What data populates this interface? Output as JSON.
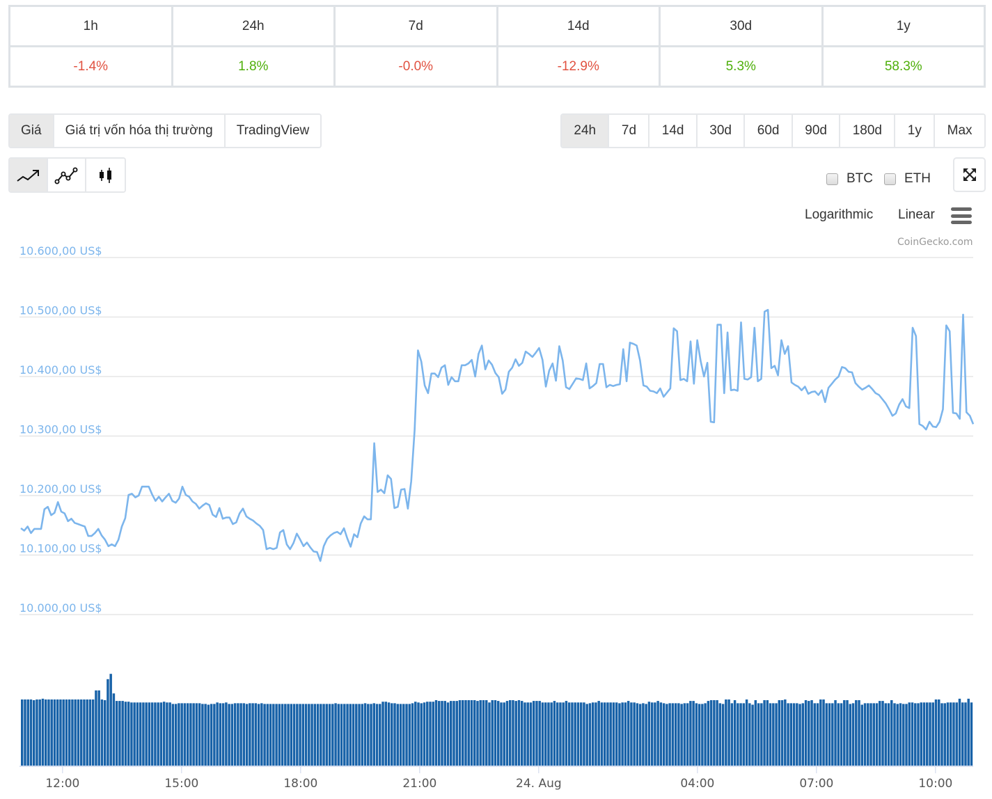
{
  "changes": {
    "periods": [
      "1h",
      "24h",
      "7d",
      "14d",
      "30d",
      "1y"
    ],
    "values": [
      {
        "text": "-1.4%",
        "dir": "neg"
      },
      {
        "text": "1.8%",
        "dir": "pos"
      },
      {
        "text": "-0.0%",
        "dir": "neg"
      },
      {
        "text": "-12.9%",
        "dir": "neg"
      },
      {
        "text": "5.3%",
        "dir": "pos"
      },
      {
        "text": "58.3%",
        "dir": "pos"
      }
    ]
  },
  "colors": {
    "negative": "#e15241",
    "positive": "#4eaf0a",
    "price_line": "#7cb5ec",
    "volume_bar": "#1862a8",
    "grid": "#e6e6e6"
  },
  "tabs": {
    "items": [
      "Giá",
      "Giá trị vốn hóa thị trường",
      "TradingView"
    ],
    "active": 0
  },
  "ranges": {
    "items": [
      "24h",
      "7d",
      "14d",
      "30d",
      "60d",
      "90d",
      "180d",
      "1y",
      "Max"
    ],
    "active": 0
  },
  "chart_types": {
    "items": [
      {
        "icon": "line-chart-icon",
        "label": "Line"
      },
      {
        "icon": "line-points-chart-icon",
        "label": "Line with points"
      },
      {
        "icon": "candlestick-chart-icon",
        "label": "Candlestick"
      }
    ],
    "active": 0
  },
  "compare": {
    "btc_label": "BTC",
    "btc_checked": false,
    "eth_label": "ETH",
    "eth_checked": false
  },
  "scale": {
    "logarithmic_label": "Logarithmic",
    "linear_label": "Linear"
  },
  "credit": "CoinGecko.com",
  "chart_data": {
    "type": "line",
    "title": "",
    "xlabel": "",
    "ylabel": "",
    "grid": true,
    "legend": "none",
    "ylim": [
      10000,
      10600
    ],
    "y_ticks": [
      {
        "value": 10600,
        "label": "10.600,00 US$"
      },
      {
        "value": 10500,
        "label": "10.500,00 US$"
      },
      {
        "value": 10400,
        "label": "10.400,00 US$"
      },
      {
        "value": 10300,
        "label": "10.300,00 US$"
      },
      {
        "value": 10200,
        "label": "10.200,00 US$"
      },
      {
        "value": 10100,
        "label": "10.100,00 US$"
      },
      {
        "value": 10000,
        "label": "10.000,00 US$"
      }
    ],
    "x_range_hours": [
      -1.05,
      22.95
    ],
    "x_ticks": [
      {
        "hour": 0,
        "label": "12:00"
      },
      {
        "hour": 3,
        "label": "15:00"
      },
      {
        "hour": 6,
        "label": "18:00"
      },
      {
        "hour": 9,
        "label": "21:00"
      },
      {
        "hour": 12,
        "label": "24. Aug"
      },
      {
        "hour": 16,
        "label": "04:00"
      },
      {
        "hour": 19,
        "label": "07:00"
      },
      {
        "hour": 22,
        "label": "10:00"
      }
    ],
    "series": [
      {
        "name": "Price (USD)",
        "x_hours_start": -1.05,
        "x_hours_step": 0.0833,
        "values": [
          10145,
          10141,
          10148,
          10137,
          10144,
          10144,
          10144,
          10177,
          10181,
          10167,
          10171,
          10189,
          10173,
          10170,
          10157,
          10161,
          10154,
          10152,
          10150,
          10148,
          10132,
          10132,
          10137,
          10144,
          10133,
          10126,
          10115,
          10118,
          10115,
          10126,
          10148,
          10162,
          10201,
          10203,
          10197,
          10200,
          10215,
          10215,
          10215,
          10202,
          10191,
          10198,
          10190,
          10197,
          10203,
          10191,
          10188,
          10195,
          10215,
          10201,
          10198,
          10190,
          10186,
          10178,
          10183,
          10187,
          10184,
          10168,
          10164,
          10179,
          10161,
          10163,
          10163,
          10152,
          10155,
          10170,
          10178,
          10165,
          10161,
          10158,
          10153,
          10149,
          10142,
          10110,
          10112,
          10110,
          10112,
          10138,
          10142,
          10118,
          10110,
          10120,
          10136,
          10126,
          10115,
          10121,
          10113,
          10106,
          10105,
          10090,
          10115,
          10127,
          10133,
          10137,
          10139,
          10135,
          10145,
          10128,
          10114,
          10135,
          10130,
          10153,
          10165,
          10160,
          10160,
          10288,
          10206,
          10210,
          10204,
          10234,
          10228,
          10179,
          10181,
          10210,
          10211,
          10178,
          10224,
          10310,
          10444,
          10425,
          10385,
          10372,
          10405,
          10405,
          10399,
          10415,
          10419,
          10386,
          10399,
          10392,
          10392,
          10419,
          10419,
          10422,
          10428,
          10400,
          10438,
          10452,
          10412,
          10427,
          10420,
          10406,
          10399,
          10371,
          10378,
          10408,
          10415,
          10429,
          10418,
          10423,
          10442,
          10438,
          10433,
          10440,
          10448,
          10428,
          10383,
          10410,
          10422,
          10393,
          10451,
          10427,
          10382,
          10379,
          10388,
          10397,
          10396,
          10394,
          10422,
          10380,
          10384,
          10389,
          10421,
          10421,
          10382,
          10386,
          10384,
          10386,
          10387,
          10446,
          10392,
          10457,
          10455,
          10452,
          10427,
          10385,
          10383,
          10376,
          10375,
          10372,
          10380,
          10366,
          10373,
          10380,
          10481,
          10476,
          10394,
          10396,
          10392,
          10459,
          10388,
          10461,
          10426,
          10400,
          10423,
          10324,
          10323,
          10487,
          10487,
          10372,
          10474,
          10377,
          10378,
          10376,
          10491,
          10396,
          10395,
          10399,
          10482,
          10392,
          10396,
          10509,
          10512,
          10414,
          10418,
          10402,
          10461,
          10438,
          10451,
          10390,
          10386,
          10383,
          10377,
          10383,
          10371,
          10374,
          10375,
          10369,
          10377,
          10357,
          10381,
          10388,
          10395,
          10400,
          10416,
          10414,
          10408,
          10407,
          10389,
          10383,
          10378,
          10381,
          10385,
          10379,
          10372,
          10369,
          10362,
          10355,
          10345,
          10334,
          10338,
          10353,
          10362,
          10350,
          10347,
          10482,
          10468,
          10320,
          10317,
          10311,
          10324,
          10316,
          10315,
          10324,
          10345,
          10486,
          10476,
          10339,
          10338,
          10329,
          10504,
          10340,
          10334,
          10320
        ]
      },
      {
        "name": "Volume",
        "values_relative": [
          0.88,
          0.88,
          0.88,
          0.88,
          0.87,
          0.88,
          0.88,
          0.89,
          0.88,
          0.88,
          0.88,
          0.88,
          0.88,
          0.88,
          0.88,
          0.88,
          0.88,
          0.88,
          0.88,
          0.88,
          0.88,
          0.88,
          0.88,
          0.88,
          0.88,
          1.0,
          1.0,
          0.88,
          0.87,
          1.15,
          1.22,
          0.96,
          0.86,
          0.86,
          0.86,
          0.85,
          0.85,
          0.84,
          0.84,
          0.84,
          0.84,
          0.84,
          0.84,
          0.84,
          0.84,
          0.84,
          0.84,
          0.84,
          0.85,
          0.84,
          0.84,
          0.82,
          0.82,
          0.83,
          0.83,
          0.83,
          0.83,
          0.83,
          0.83,
          0.83,
          0.83,
          0.82,
          0.82,
          0.81,
          0.82,
          0.82,
          0.84,
          0.83,
          0.83,
          0.84,
          0.82,
          0.82,
          0.83,
          0.83,
          0.83,
          0.83,
          0.82,
          0.83,
          0.83,
          0.83,
          0.82,
          0.83,
          0.82,
          0.82,
          0.82,
          0.82,
          0.82,
          0.82,
          0.82,
          0.82,
          0.82,
          0.82,
          0.82,
          0.82,
          0.82,
          0.82,
          0.82,
          0.82,
          0.82,
          0.82,
          0.82,
          0.82,
          0.82,
          0.82,
          0.82,
          0.82,
          0.83,
          0.82,
          0.82,
          0.82,
          0.82,
          0.82,
          0.82,
          0.82,
          0.82,
          0.82,
          0.83,
          0.82,
          0.82,
          0.83,
          0.82,
          0.82,
          0.85,
          0.85,
          0.84,
          0.83,
          0.83,
          0.82,
          0.82,
          0.82,
          0.82,
          0.82,
          0.83,
          0.85,
          0.84,
          0.83,
          0.84,
          0.85,
          0.85,
          0.85,
          0.87,
          0.86,
          0.86,
          0.86,
          0.84,
          0.86,
          0.86,
          0.86,
          0.87,
          0.87,
          0.87,
          0.87,
          0.87,
          0.87,
          0.86,
          0.87,
          0.87,
          0.87,
          0.84,
          0.87,
          0.87,
          0.86,
          0.84,
          0.84,
          0.86,
          0.87,
          0.87,
          0.86,
          0.87,
          0.86,
          0.84,
          0.84,
          0.84,
          0.86,
          0.86,
          0.86,
          0.84,
          0.84,
          0.84,
          0.84,
          0.86,
          0.84,
          0.84,
          0.84,
          0.86,
          0.84,
          0.84,
          0.84,
          0.84,
          0.84,
          0.84,
          0.82,
          0.83,
          0.84,
          0.84,
          0.86,
          0.84,
          0.84,
          0.84,
          0.84,
          0.84,
          0.84,
          0.83,
          0.84,
          0.84,
          0.86,
          0.84,
          0.84,
          0.83,
          0.82,
          0.83,
          0.82,
          0.85,
          0.84,
          0.84,
          0.86,
          0.84,
          0.83,
          0.82,
          0.83,
          0.83,
          0.83,
          0.83,
          0.82,
          0.83,
          0.83,
          0.86,
          0.86,
          0.83,
          0.82,
          0.82,
          0.83,
          0.86,
          0.87,
          0.87,
          0.87,
          0.83,
          0.82,
          0.88,
          0.88,
          0.83,
          0.87,
          0.83,
          0.83,
          0.83,
          0.88,
          0.83,
          0.81,
          0.87,
          0.83,
          0.83,
          0.87,
          0.87,
          0.83,
          0.83,
          0.83,
          0.87,
          0.87,
          0.88,
          0.83,
          0.83,
          0.83,
          0.83,
          0.82,
          0.83,
          0.87,
          0.86,
          0.87,
          0.83,
          0.83,
          0.88,
          0.88,
          0.83,
          0.83,
          0.83,
          0.87,
          0.83,
          0.83,
          0.87,
          0.87,
          0.82,
          0.83,
          0.87,
          0.87,
          0.81,
          0.83,
          0.83,
          0.83,
          0.83,
          0.83,
          0.86,
          0.86,
          0.83,
          0.83,
          0.87,
          0.83,
          0.82,
          0.83,
          0.82,
          0.82,
          0.84,
          0.84,
          0.83,
          0.83,
          0.84,
          0.84,
          0.84,
          0.84,
          0.84,
          0.88,
          0.88,
          0.83,
          0.83,
          0.84,
          0.84,
          0.84,
          0.84,
          0.89,
          0.84,
          0.84,
          0.89,
          0.84
        ]
      }
    ]
  }
}
